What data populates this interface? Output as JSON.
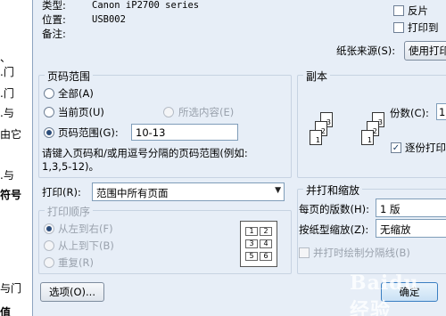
{
  "background_document": {
    "lines": [
      {
        "text": "、"
      },
      {
        "text": ".门"
      },
      {
        "text": ".门"
      },
      {
        "text": ".与"
      },
      {
        "text": "由它"
      },
      {
        "text": ".与"
      },
      {
        "text": "符号"
      },
      {
        "text": "与门"
      },
      {
        "text": "值"
      }
    ]
  },
  "printer_info": {
    "type_label": "类型:",
    "type_value": "Canon iP2700 series",
    "location_label": "位置:",
    "location_value": "USB002",
    "comment_label": "备注:",
    "reverse_label": "反片",
    "print_to_file_label": "打印到",
    "paper_source_label": "纸张来源(S):",
    "paper_source_value": "使用打印"
  },
  "page_range": {
    "title": "页码范围",
    "all_label": "全部(A)",
    "current_page_label": "当前页(U)",
    "selection_label": "所选内容(E)",
    "pages_label": "页码范围(G):",
    "pages_value": "10-13",
    "hint_line1": "请键入页码和/或用逗号分隔的页码范围(例如:",
    "hint_line2": "1,3,5-12)。"
  },
  "copies": {
    "title": "副本",
    "count_label": "份数(C):",
    "count_value": "1",
    "collate_label": "逐份打印",
    "page_icons": [
      "3",
      "2",
      "1",
      "3",
      "2",
      "1"
    ]
  },
  "print_what": {
    "label": "打印(R):",
    "value": "范围中所有页面"
  },
  "print_order": {
    "title": "打印顺序",
    "left_to_right": "从左到右(F)",
    "top_to_bottom": "从上到下(B)",
    "repeat": "重复(R)",
    "preview_cells": [
      "1",
      "2",
      "3",
      "4",
      "5",
      "6"
    ]
  },
  "zoom": {
    "title": "并打和缩放",
    "pages_per_sheet_label": "每页的版数(H):",
    "pages_per_sheet_value": "1 版",
    "scale_label": "按纸型缩放(Z):",
    "scale_value": "无缩放",
    "draw_borders_label": "并打时绘制分隔线(B)"
  },
  "footer": {
    "options_label": "选项(O)...",
    "ok_label": "确定"
  },
  "watermark_text": "Baidu 经验"
}
